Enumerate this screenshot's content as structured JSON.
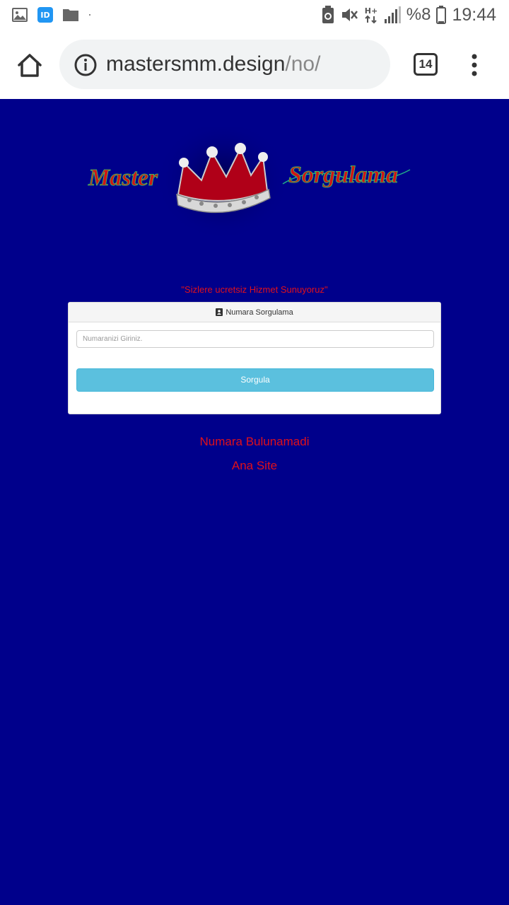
{
  "status_bar": {
    "left_icons": [
      "gallery-icon",
      "app-icon",
      "folder-icon",
      "dot-icon"
    ],
    "right_icons": [
      "battery-saver-icon",
      "mute-icon",
      "network-hplus-icon",
      "signal-icon"
    ],
    "network_label": "H+",
    "battery_percent": "%8",
    "time": "19:44"
  },
  "browser": {
    "url_host": "mastersmm.design",
    "url_path": "/no/",
    "tab_count": "14"
  },
  "page": {
    "logo": {
      "word_left": "Master",
      "word_right": "Sorgulama"
    },
    "tagline": "\"Sizlere ucretsiz Hizmet Sunuyoruz\"",
    "panel": {
      "title": "Numara Sorgulama",
      "input_placeholder": "Numaranizi Giriniz.",
      "input_value": "",
      "button_label": "Sorgula"
    },
    "result_message": "Numara Bulunamadi",
    "home_link": "Ana Site"
  },
  "colors": {
    "background": "#00008b",
    "accent_red": "#e0101a",
    "button": "#5bc0de"
  }
}
